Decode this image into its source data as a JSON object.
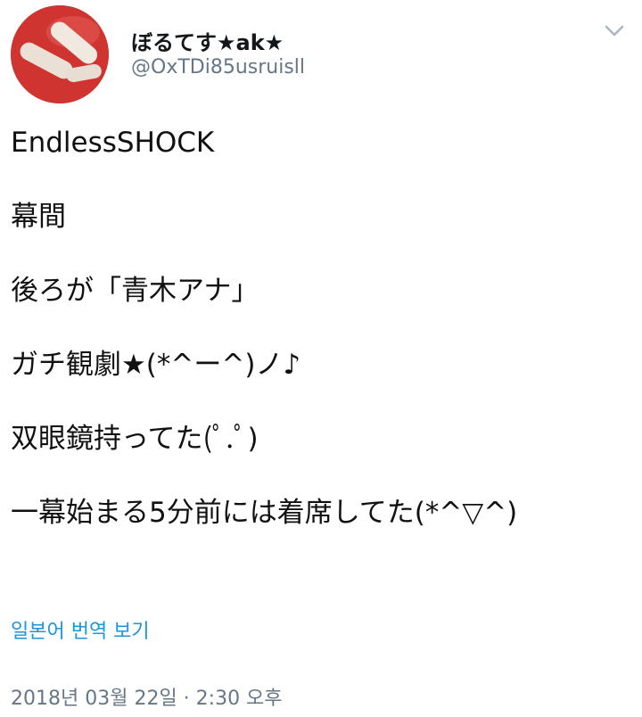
{
  "user": {
    "display_name": "ぼるてす★ak★",
    "handle": "@OxTDi85usruisll"
  },
  "tweet": {
    "lines": [
      "EndlessSHOCK",
      "幕間",
      "後ろが「青木アナ」",
      "ガチ観劇★(*^ー^)ノ♪",
      "双眼鏡持ってた(ﾟ.ﾟ)",
      "一幕始まる5分前には着席してた(*^▽^)"
    ],
    "translate_label": "일본어 번역 보기",
    "timestamp": "2018년 03월 22일 · 2:30 오후"
  },
  "icons": {
    "menu": "chevron-down-icon",
    "avatar": "avatar-apple-hand-photo"
  },
  "colors": {
    "link": "#1b95e0",
    "secondary_text": "#657786",
    "avatar_red": "#c42a2a"
  }
}
